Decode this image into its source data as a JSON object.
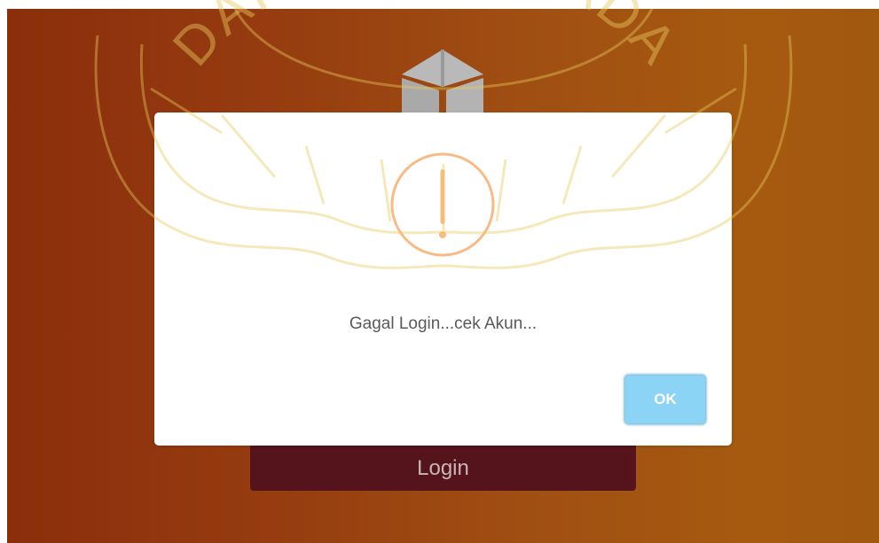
{
  "login_page": {
    "login_button_label": "Login",
    "logo_icon": "cube-logo-icon"
  },
  "alert": {
    "icon": "warning-exclamation-icon",
    "message": "Gagal Login...cek Akun...",
    "ok_label": "OK"
  },
  "watermark": {
    "text": "DARMA PERSADA"
  },
  "colors": {
    "background_gradient_start": "#8a2e0c",
    "background_gradient_end": "#a1580f",
    "login_button": "#55141c",
    "ok_button": "#8cd4f5",
    "warning": "#f8bb86",
    "watermark": "#f0d97a"
  }
}
